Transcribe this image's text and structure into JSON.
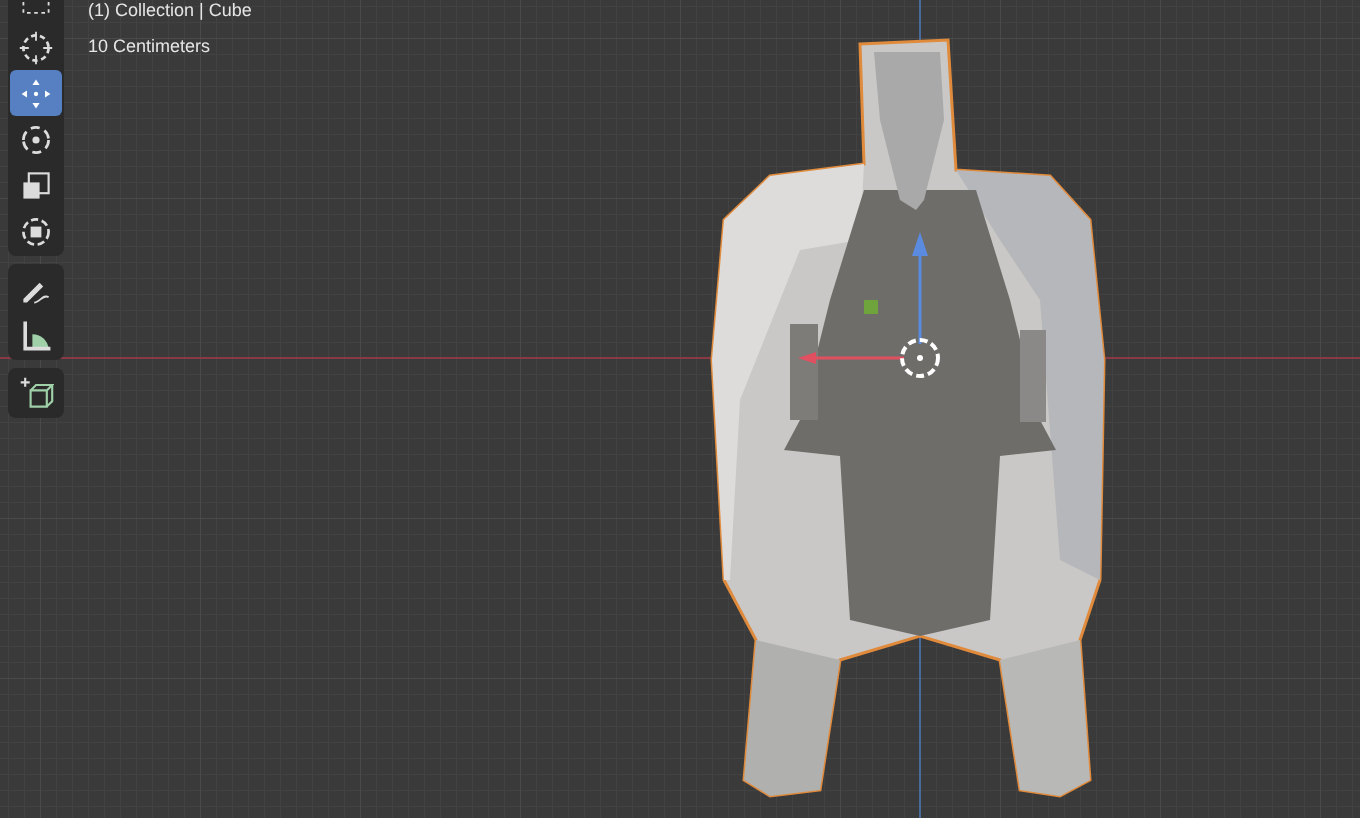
{
  "viewport": {
    "overlay_text": [
      "(1) Collection | Cube",
      "10 Centimeters"
    ]
  },
  "toolbar": {
    "groups": [
      [
        {
          "kind": "select_box",
          "selected": false
        },
        {
          "kind": "cursor",
          "selected": false
        },
        {
          "kind": "move",
          "selected": true
        },
        {
          "kind": "rotate",
          "selected": false
        },
        {
          "kind": "scale",
          "selected": false
        },
        {
          "kind": "transform",
          "selected": false
        }
      ],
      [
        {
          "kind": "annotate",
          "selected": false
        },
        {
          "kind": "measure",
          "selected": false
        }
      ],
      [
        {
          "kind": "add_cube",
          "selected": false
        }
      ]
    ]
  }
}
